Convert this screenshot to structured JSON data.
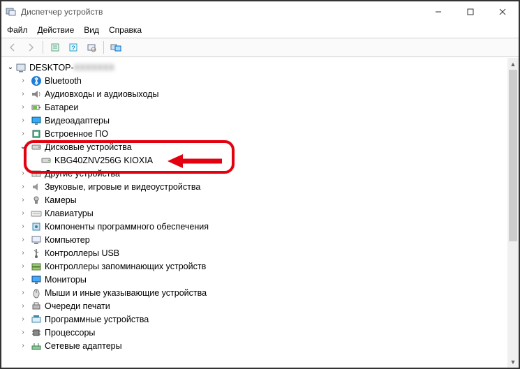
{
  "window": {
    "title": "Диспетчер устройств"
  },
  "menu": {
    "file": "Файл",
    "action": "Действие",
    "view": "Вид",
    "help": "Справка"
  },
  "tree": {
    "root": "DESKTOP-",
    "items": [
      {
        "label": "Bluetooth",
        "expanded": false,
        "icon": "bluetooth"
      },
      {
        "label": "Аудиовходы и аудиовыходы",
        "expanded": false,
        "icon": "audio"
      },
      {
        "label": "Батареи",
        "expanded": false,
        "icon": "battery"
      },
      {
        "label": "Видеоадаптеры",
        "expanded": false,
        "icon": "display"
      },
      {
        "label": "Встроенное ПО",
        "expanded": false,
        "icon": "firmware"
      },
      {
        "label": "Дисковые устройства",
        "expanded": true,
        "icon": "disk",
        "children": [
          {
            "label": "KBG40ZNV256G KIOXIA",
            "icon": "disk"
          }
        ]
      },
      {
        "label": "Другие устройства",
        "expanded": false,
        "icon": "other"
      },
      {
        "label": "Звуковые, игровые и видеоустройства",
        "expanded": false,
        "icon": "sound"
      },
      {
        "label": "Камеры",
        "expanded": false,
        "icon": "camera"
      },
      {
        "label": "Клавиатуры",
        "expanded": false,
        "icon": "keyboard"
      },
      {
        "label": "Компоненты программного обеспечения",
        "expanded": false,
        "icon": "component"
      },
      {
        "label": "Компьютер",
        "expanded": false,
        "icon": "computer"
      },
      {
        "label": "Контроллеры USB",
        "expanded": false,
        "icon": "usb"
      },
      {
        "label": "Контроллеры запоминающих устройств",
        "expanded": false,
        "icon": "storagectl"
      },
      {
        "label": "Мониторы",
        "expanded": false,
        "icon": "monitor"
      },
      {
        "label": "Мыши и иные указывающие устройства",
        "expanded": false,
        "icon": "mouse"
      },
      {
        "label": "Очереди печати",
        "expanded": false,
        "icon": "printer"
      },
      {
        "label": "Программные устройства",
        "expanded": false,
        "icon": "software"
      },
      {
        "label": "Процессоры",
        "expanded": false,
        "icon": "cpu"
      },
      {
        "label": "Сетевые адаптеры",
        "expanded": false,
        "icon": "network"
      }
    ]
  },
  "annotation": {
    "highlight_index": 5,
    "arrow_color": "#e3000f"
  }
}
